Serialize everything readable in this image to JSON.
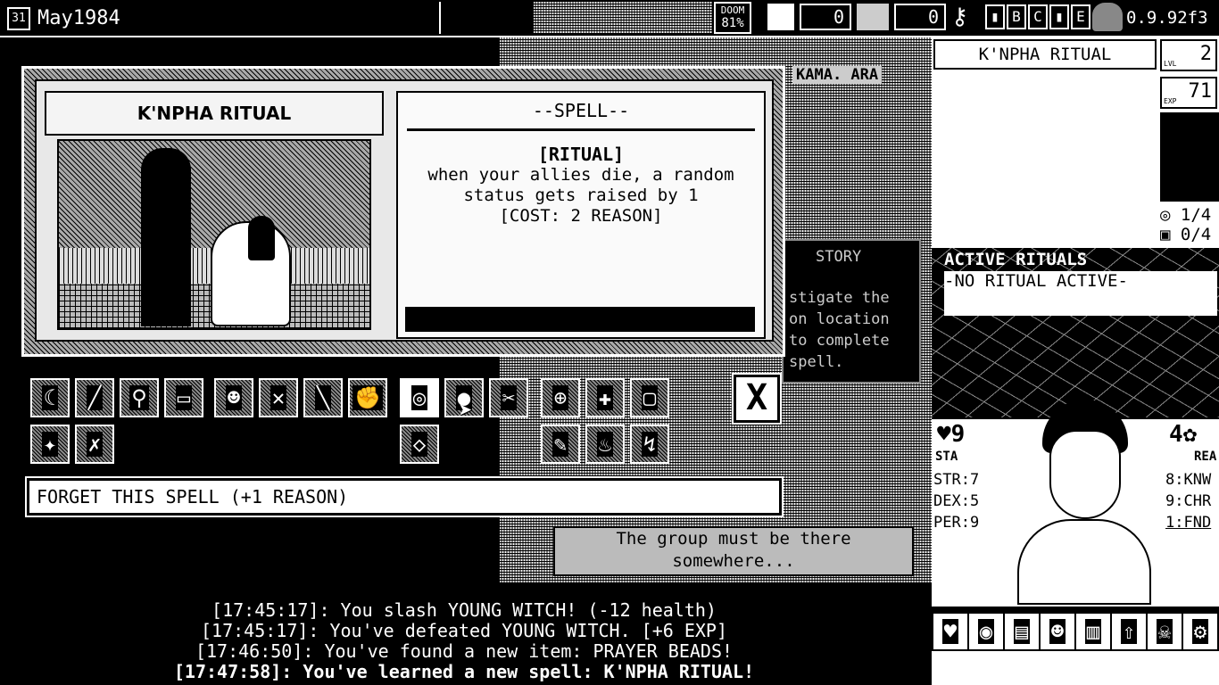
{
  "topbar": {
    "calendar_day": "31",
    "date": "May1984",
    "doom_label": "DOOM",
    "doom_value": "81%",
    "counter1": "0",
    "counter2": "0",
    "key_letters": [
      "B",
      "C",
      "E"
    ],
    "version": "0.9.92f3"
  },
  "spell_card": {
    "name": "K'NPHA RITUAL",
    "type_header": "--SPELL--",
    "subtype": "[RITUAL]",
    "description": "when your allies die, a random status gets raised by 1",
    "cost": "[COST: 2 REASON]"
  },
  "background_text": {
    "location": "KAMA. ARA",
    "story": "STORY",
    "instr1": "stigate the",
    "instr2": "on location",
    "instr3": "to complete",
    "instr4": "spell.",
    "message1": "The group must be there",
    "message2": "somewhere..."
  },
  "action_icons_row1": [
    "moon-icon",
    "slash-icon",
    "magnify-icon",
    "book-icon",
    "people-icon",
    "cross-person-icon",
    "knife-icon",
    "fist-icon",
    "spiral-icon",
    "blob-icon",
    "cut-icon",
    "target-icon",
    "plus-icon",
    "blank-icon"
  ],
  "action_icons_row2": [
    "torch-icon",
    "swords-icon",
    "diamond-icon",
    "wrench-icon",
    "fire-icon",
    "run-icon"
  ],
  "close_label": "X",
  "forget_label": "FORGET THIS SPELL (+1 REASON)",
  "log": [
    "[17:45:17]: You slash YOUNG WITCH! (-12 health)",
    "[17:45:17]: You've defeated YOUNG WITCH. [+6 EXP]",
    "[17:46:50]: You've found a new item: PRAYER BEADS!",
    "[17:47:58]: You've learned a new spell: K'NPHA RITUAL!"
  ],
  "right_panel": {
    "title": "K'NPHA RITUAL",
    "level_label": "LVL",
    "level": "2",
    "exp_label": "EXP",
    "exp": "71",
    "spells_count": "1/4",
    "items_count": "0/4",
    "active_rituals_title": "ACTIVE RITUALS",
    "active_rituals_value": "-NO RITUAL ACTIVE-",
    "stamina": "9",
    "stamina_label": "STA",
    "reason": "4",
    "reason_label": "REA",
    "str": "STR:7",
    "dex": "DEX:5",
    "per": "PER:9",
    "knw": "8:KNW",
    "chr": "9:CHR",
    "fnd": "1:FND"
  },
  "bottom_icons": [
    "heart-icon",
    "eye-icon",
    "chart-icon",
    "mask-icon",
    "building-icon",
    "door-icon",
    "cthulhu-icon",
    "gear-icon"
  ]
}
